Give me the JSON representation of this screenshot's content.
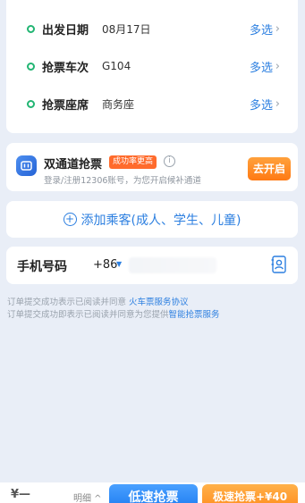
{
  "trip": {
    "rows": [
      {
        "label": "出发日期",
        "value": "08月17日",
        "action": "多选"
      },
      {
        "label": "抢票车次",
        "value": "G104",
        "action": "多选"
      },
      {
        "label": "抢票座席",
        "value": "商务座",
        "action": "多选"
      }
    ],
    "chevron": "›"
  },
  "dual_channel": {
    "title": "双通道抢票",
    "badge": "成功率更高",
    "info": "i",
    "subtitle": "登录/注册12306账号，为您开启候补通道",
    "button": "去开启"
  },
  "add_passenger": {
    "label": "添加乘客(成人、学生、儿童)"
  },
  "phone": {
    "label": "手机号码",
    "country_code": "+86"
  },
  "agreements": [
    {
      "text": "订单提交成功表示已阅读并同意 ",
      "link": "火车票服务协议"
    },
    {
      "text": "订单提交成功即表示已阅读并同意为您提供",
      "link": "智能抢票服务"
    }
  ],
  "bottom": {
    "price": "¥—",
    "detail": "明细 ^",
    "slow_button": "低速抢票",
    "fast_button": "极速抢票+¥40"
  },
  "colors": {
    "accent_blue": "#2c7fe0",
    "green_dot": "#22b573",
    "orange": "#ff7a14",
    "background": "#e9eef7"
  }
}
